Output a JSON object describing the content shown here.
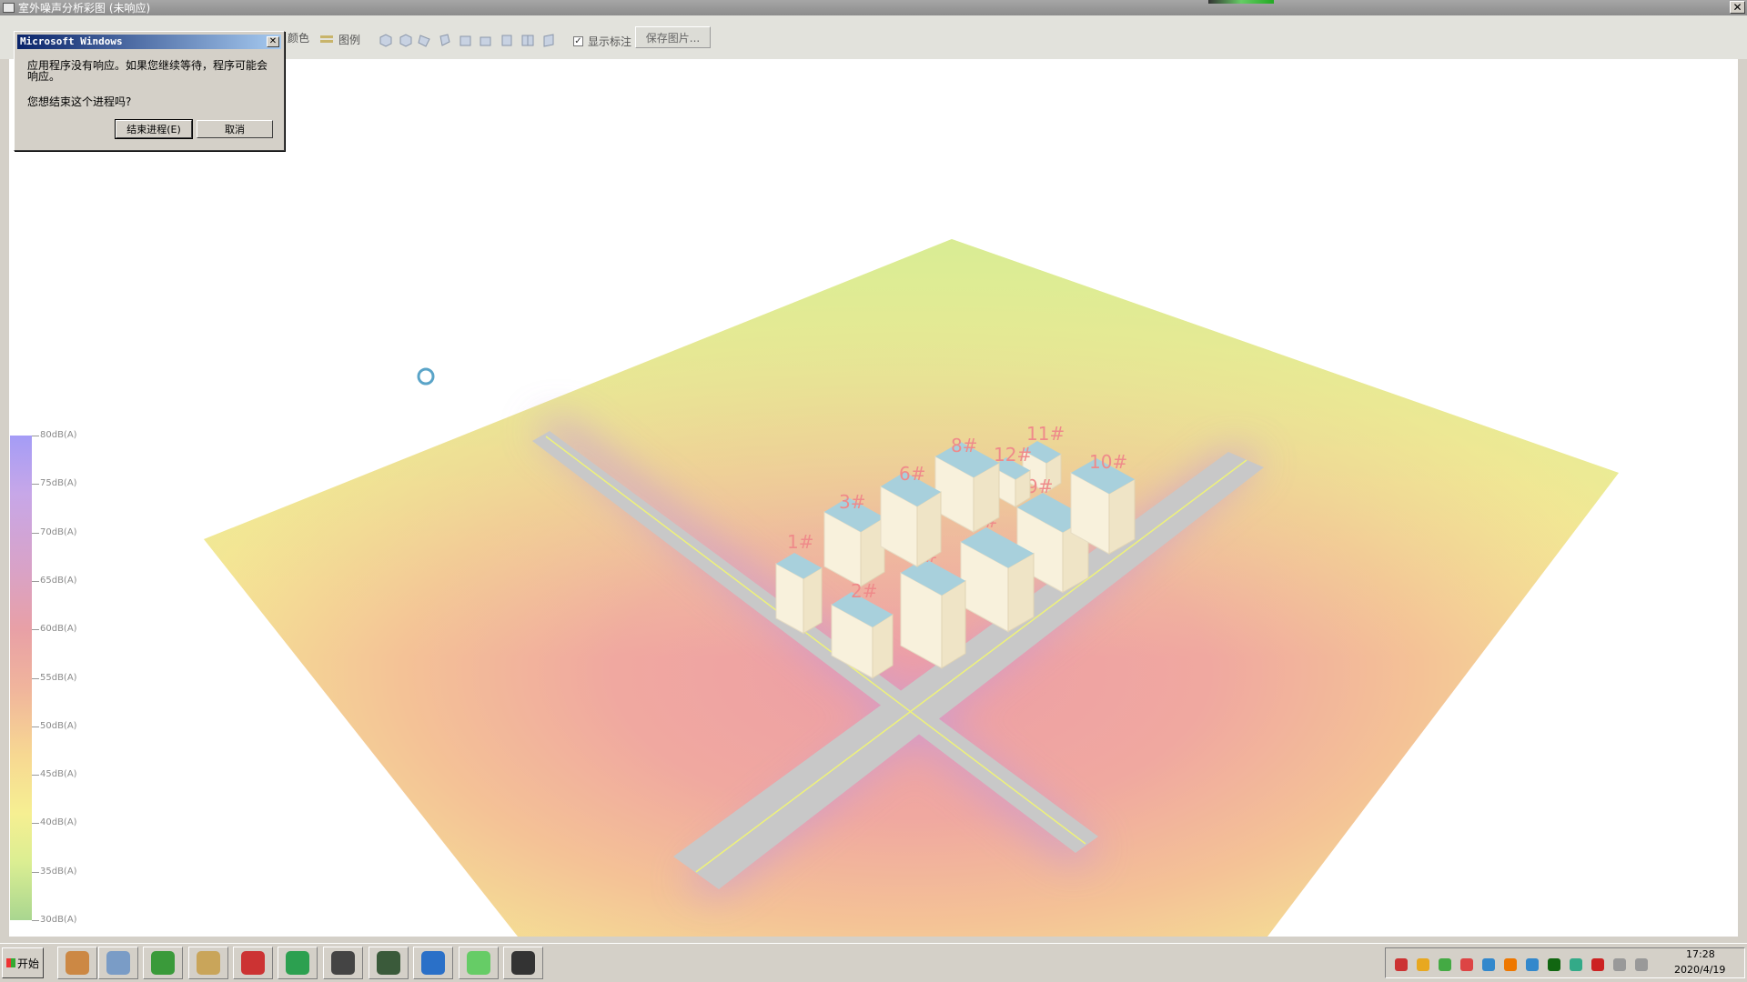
{
  "window": {
    "title": "室外噪声分析彩图 (未响应)",
    "close_glyph": "✕"
  },
  "toolbar": {
    "color_label": "颜色",
    "legend_label": "图例",
    "show_labels_label": "显示标注",
    "show_labels_checked": "✓",
    "save_image_label": "保存图片..."
  },
  "scene": {
    "buildings": [
      "1#",
      "2#",
      "3#",
      "5#",
      "6#",
      "7#",
      "8#",
      "9#",
      "10#",
      "11#",
      "12#"
    ]
  },
  "color_scale": {
    "labels": [
      "80dB(A)",
      "75dB(A)",
      "70dB(A)",
      "65dB(A)",
      "60dB(A)",
      "55dB(A)",
      "50dB(A)",
      "45dB(A)",
      "40dB(A)",
      "35dB(A)",
      "30dB(A)"
    ]
  },
  "dialog": {
    "title": "Microsoft Windows",
    "close_glyph": "✕",
    "message": "应用程序没有响应。如果您继续等待，程序可能会响应。",
    "question": "您想结束这个进程吗?",
    "end_process_label": "结束进程(E)",
    "cancel_label": "取消"
  },
  "taskbar": {
    "start_label": "开始",
    "apps": [
      "tomato-app-icon",
      "calculator-icon",
      "browser-icon",
      "file-explorer-icon",
      "autocad-icon",
      "wps-icon",
      "avatar-app-icon",
      "screen-monitor-icon",
      "uu-accelerator-icon",
      "wechat-icon",
      "obs-icon"
    ],
    "clock_time": "17:28",
    "clock_date": "2020/4/19"
  }
}
